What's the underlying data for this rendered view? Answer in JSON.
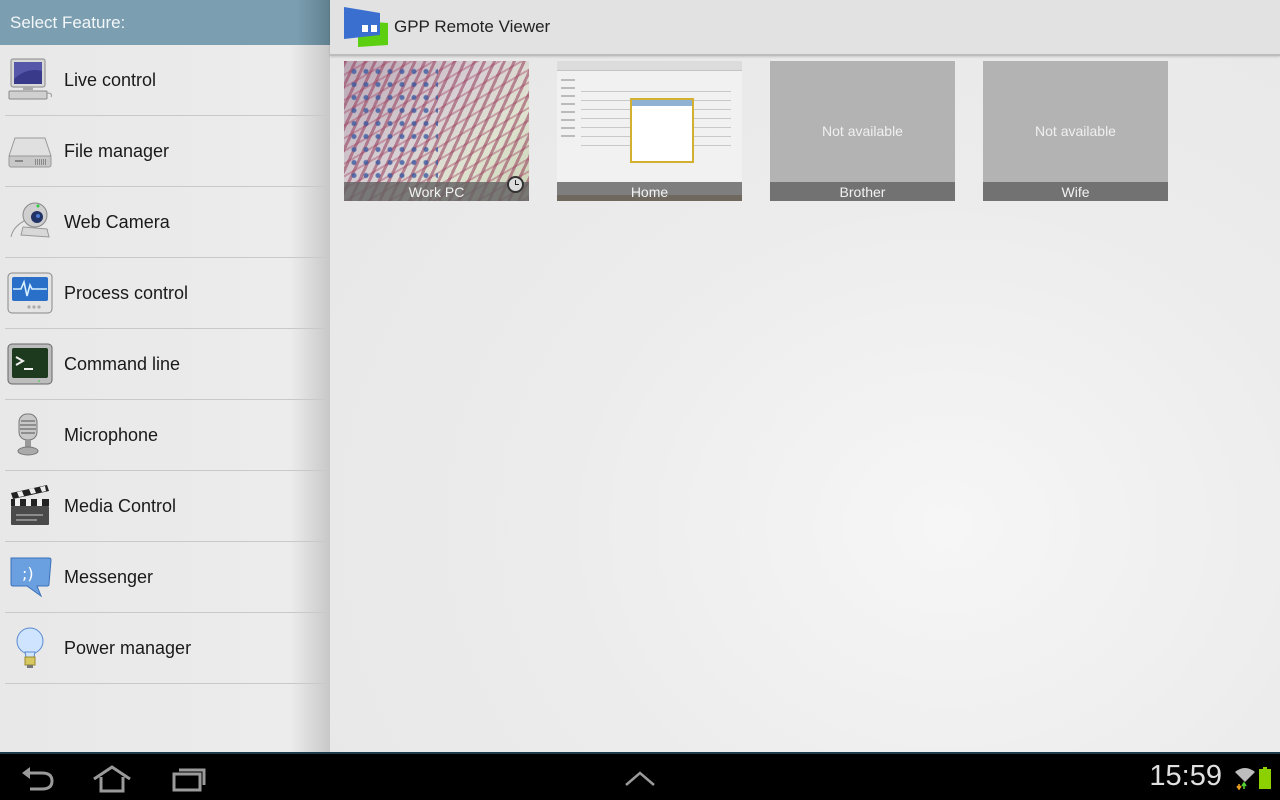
{
  "sidebar": {
    "header": "Select Feature:",
    "items": [
      {
        "label": "Live control",
        "icon": "computer-icon"
      },
      {
        "label": "File manager",
        "icon": "hard-drive-icon"
      },
      {
        "label": "Web Camera",
        "icon": "webcam-icon"
      },
      {
        "label": "Process control",
        "icon": "heartbeat-monitor-icon"
      },
      {
        "label": "Command line",
        "icon": "terminal-icon"
      },
      {
        "label": "Microphone",
        "icon": "microphone-icon"
      },
      {
        "label": "Media Control",
        "icon": "clapperboard-icon"
      },
      {
        "label": "Messenger",
        "icon": "chat-bubble-icon"
      },
      {
        "label": "Power manager",
        "icon": "light-bulb-icon"
      }
    ]
  },
  "header": {
    "title": "GPP Remote Viewer",
    "logo_colors": {
      "blue": "#3a6fd0",
      "green": "#5ccf10"
    }
  },
  "computers": [
    {
      "name": "Work PC",
      "status": "available",
      "thumbnail": "desktop screenshot",
      "badge": "clock-icon"
    },
    {
      "name": "Home",
      "status": "available",
      "thumbnail": "browser screenshot"
    },
    {
      "name": "Brother",
      "status": "unavailable",
      "status_text": "Not available"
    },
    {
      "name": "Wife",
      "status": "unavailable",
      "status_text": "Not available"
    }
  ],
  "navbar": {
    "buttons": [
      "back",
      "home",
      "recent-apps",
      "expand"
    ],
    "time": "15:59",
    "battery_color": "#8cd000"
  },
  "colors": {
    "sidebar_header": "#7b9eb0",
    "tile_placeholder": "#b3b3b3",
    "tile_caption": "#6e6e6e"
  }
}
